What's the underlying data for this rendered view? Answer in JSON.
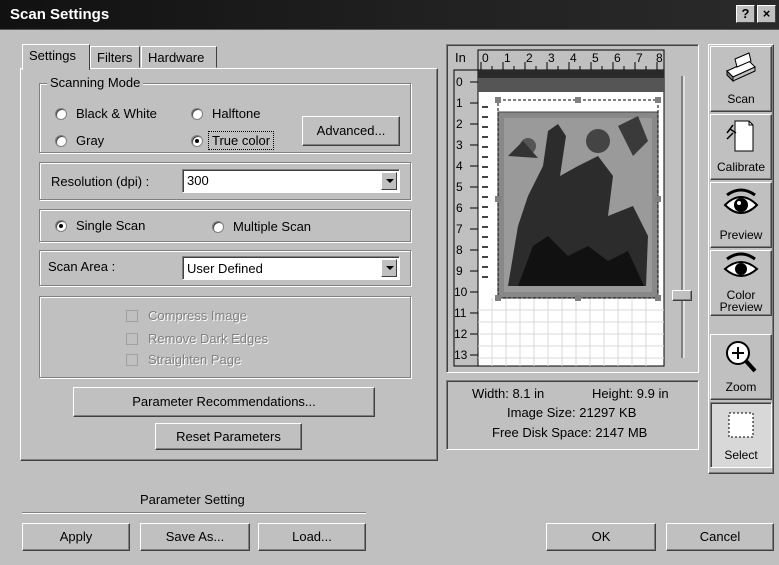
{
  "window": {
    "title": "Scan Settings",
    "help_btn": "?",
    "close_btn": "×"
  },
  "tabs": [
    "Settings",
    "Filters",
    "Hardware"
  ],
  "scanning_mode": {
    "label": "Scanning Mode",
    "options": [
      "Black & White",
      "Halftone",
      "Gray",
      "True color"
    ],
    "selected": "True color",
    "advanced_label": "Advanced..."
  },
  "resolution": {
    "label": "Resolution (dpi) :",
    "value": "300"
  },
  "scan_type": {
    "options": [
      "Single Scan",
      "Multiple Scan"
    ],
    "selected": "Single Scan"
  },
  "scan_area": {
    "label": "Scan Area :",
    "value": "User Defined"
  },
  "checkboxes": [
    "Compress Image",
    "Remove Dark Edges",
    "Straighten Page"
  ],
  "buttons": {
    "param_recommend": "Parameter Recommendations...",
    "reset": "Reset Parameters",
    "apply": "Apply",
    "save_as": "Save As...",
    "load": "Load...",
    "ok": "OK",
    "cancel": "Cancel"
  },
  "parameter_setting_label": "Parameter Setting",
  "preview": {
    "unit": "In",
    "ruler_h": [
      "0",
      "1",
      "2",
      "3",
      "4",
      "5",
      "6",
      "7",
      "8"
    ],
    "ruler_v": [
      "0",
      "1",
      "2",
      "3",
      "4",
      "5",
      "6",
      "7",
      "8",
      "9",
      "10",
      "11",
      "12",
      "13"
    ]
  },
  "info": {
    "width": "Width:  8.1 in",
    "height": "Height:  9.9 in",
    "image_size": "Image Size: 21297 KB",
    "free_disk": "Free Disk Space: 2147 MB"
  },
  "tools": [
    {
      "label": "Scan",
      "icon": "scanner-icon"
    },
    {
      "label": "Calibrate",
      "icon": "calibrate-icon"
    },
    {
      "label": "Preview",
      "icon": "eye-icon"
    },
    {
      "label": "Color Preview",
      "icon": "color-eye-icon"
    },
    {
      "label": "Zoom",
      "icon": "zoom-icon"
    },
    {
      "label": "Select",
      "icon": "select-icon"
    }
  ]
}
